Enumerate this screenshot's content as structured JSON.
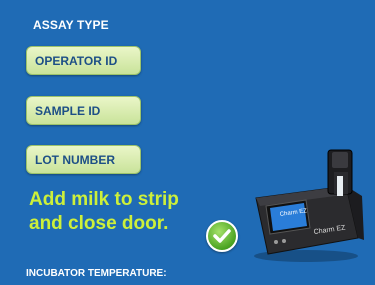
{
  "header": {
    "title": "ASSAY TYPE"
  },
  "fields": [
    {
      "label": "OPERATOR ID"
    },
    {
      "label": "SAMPLE ID"
    },
    {
      "label": "LOT NUMBER"
    }
  ],
  "message": {
    "line1": "Add milk to strip",
    "line2": "and close door."
  },
  "footer": {
    "label": "INCUBATOR TEMPERATURE:"
  },
  "device": {
    "brand": "Charm EZ",
    "screen_brand": "Charm EZ"
  },
  "icons": {
    "confirm": "check-circle-icon"
  },
  "colors": {
    "background": "#1f6bb5",
    "pill": "#d7ecb0",
    "pill_text": "#1d4f86",
    "message": "#cdf03a",
    "check": "#4aa321"
  }
}
